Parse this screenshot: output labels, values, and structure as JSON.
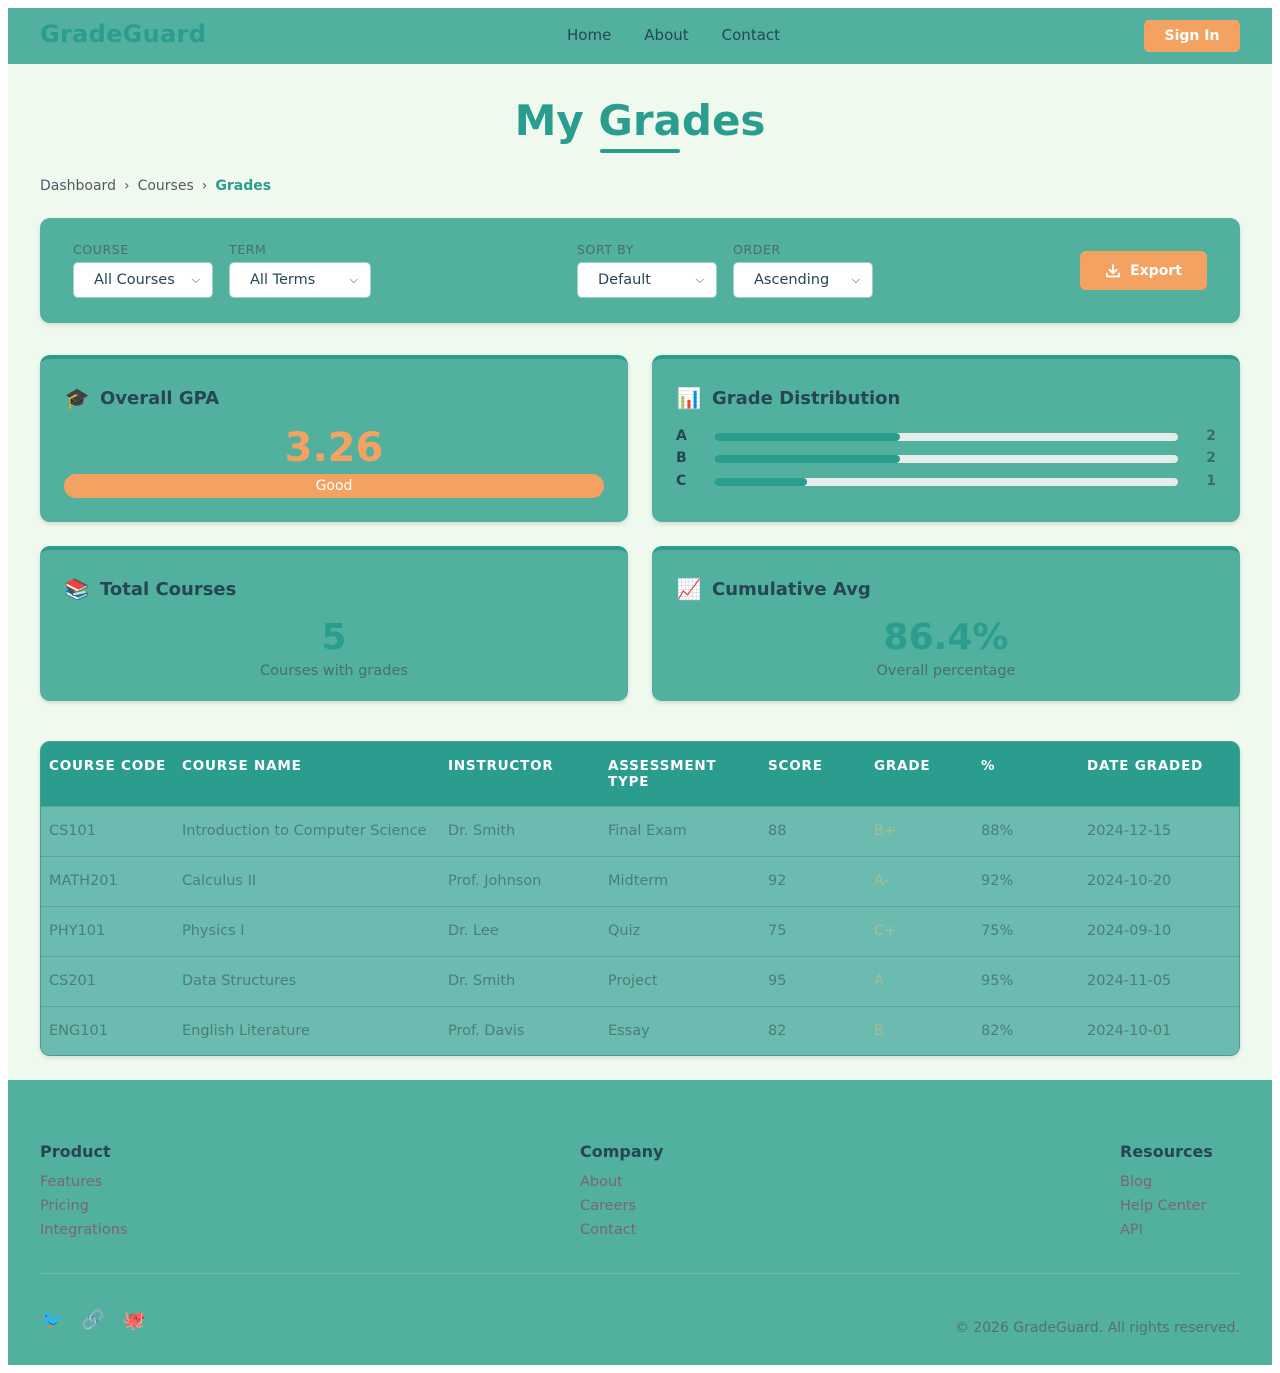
{
  "header": {
    "brand": "GradeGuard",
    "nav": [
      "Home",
      "About",
      "Contact"
    ],
    "sign_in": "Sign In"
  },
  "page": {
    "title": "My Grades",
    "breadcrumb": [
      "Dashboard",
      "Courses",
      "Grades"
    ],
    "breadcrumb_separator": "›"
  },
  "filters": {
    "course": {
      "label": "COURSE",
      "value": "All Courses"
    },
    "term": {
      "label": "TERM",
      "value": "All Terms"
    },
    "sort_by": {
      "label": "SORT BY",
      "value": "Default"
    },
    "order": {
      "label": "ORDER",
      "value": "Ascending"
    },
    "export_label": "Export"
  },
  "cards": {
    "gpa": {
      "icon": "graduation-cap-icon",
      "title": "Overall GPA",
      "value": "3.26",
      "badge": "Good"
    },
    "distribution": {
      "icon": "bar-chart-icon",
      "title": "Grade Distribution",
      "max": 5,
      "rows": [
        {
          "letter": "A",
          "count": 2
        },
        {
          "letter": "B",
          "count": 2
        },
        {
          "letter": "C",
          "count": 1
        }
      ]
    },
    "total_courses": {
      "icon": "books-icon",
      "title": "Total Courses",
      "value": "5",
      "sub": "Courses with grades"
    },
    "cumulative": {
      "icon": "chart-increasing-icon",
      "title": "Cumulative Avg",
      "value": "86.4%",
      "sub": "Overall percentage"
    }
  },
  "table": {
    "columns": [
      "COURSE CODE",
      "COURSE NAME",
      "INSTRUCTOR",
      "ASSESSMENT TYPE",
      "SCORE",
      "GRADE",
      "%",
      "DATE GRADED"
    ],
    "rows": [
      [
        "CS101",
        "Introduction to Computer Science",
        "Dr. Smith",
        "Final Exam",
        "88",
        "B+",
        "88%",
        "2024-12-15"
      ],
      [
        "MATH201",
        "Calculus II",
        "Prof. Johnson",
        "Midterm",
        "92",
        "A-",
        "92%",
        "2024-10-20"
      ],
      [
        "PHY101",
        "Physics I",
        "Dr. Lee",
        "Quiz",
        "75",
        "C+",
        "75%",
        "2024-09-10"
      ],
      [
        "CS201",
        "Data Structures",
        "Dr. Smith",
        "Project",
        "95",
        "A",
        "95%",
        "2024-11-05"
      ],
      [
        "ENG101",
        "English Literature",
        "Prof. Davis",
        "Essay",
        "82",
        "B",
        "82%",
        "2024-10-01"
      ]
    ]
  },
  "footer": {
    "columns": [
      {
        "title": "Product",
        "links": [
          "Features",
          "Pricing",
          "Integrations"
        ]
      },
      {
        "title": "Company",
        "links": [
          "About",
          "Careers",
          "Contact"
        ]
      },
      {
        "title": "Resources",
        "links": [
          "Blog",
          "Help Center",
          "API"
        ]
      }
    ],
    "socials": [
      "twitter-icon",
      "link-icon",
      "github-icon"
    ],
    "copyright": "© 2026 GradeGuard. All rights reserved."
  },
  "colors": {
    "primary": "#2a9d8f",
    "accent": "#f4a261",
    "panel": "#52b09f",
    "text": "#264653"
  }
}
